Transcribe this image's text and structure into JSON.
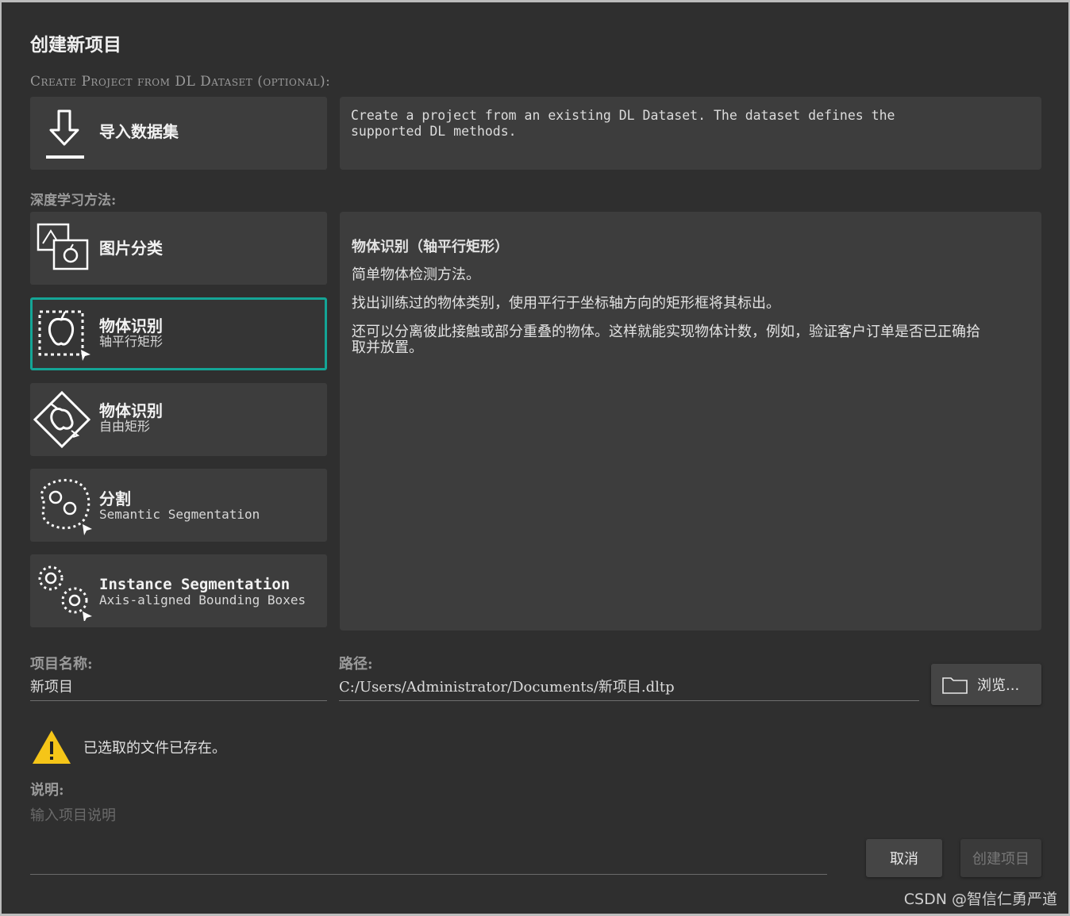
{
  "dialog": {
    "title": "创建新项目",
    "import_section_label": "Create Project from DL Dataset (optional):",
    "import_button_label": "导入数据集",
    "import_description": "Create a project from an existing DL Dataset. The dataset defines the\nsupported DL methods.",
    "methods_label": "深度学习方法:",
    "methods": [
      {
        "main": "图片分类",
        "sub": "",
        "icon": "image-classification-icon",
        "selected": false
      },
      {
        "main": "物体识别",
        "sub": "轴平行矩形",
        "icon": "object-detection-axis-aligned-icon",
        "selected": true
      },
      {
        "main": "物体识别",
        "sub": "自由矩形",
        "icon": "object-detection-rotated-icon",
        "selected": false
      },
      {
        "main": "分割",
        "sub": "Semantic Segmentation",
        "icon": "semantic-segmentation-icon",
        "selected": false
      },
      {
        "main": "Instance Segmentation",
        "sub": "Axis-aligned Bounding Boxes",
        "icon": "instance-segmentation-icon",
        "selected": false
      }
    ],
    "method_description": {
      "heading": "物体识别（轴平行矩形）",
      "paragraphs": [
        "简单物体检测方法。",
        "找出训练过的物体类别，使用平行于坐标轴方向的矩形框将其标出。",
        "还可以分离彼此接触或部分重叠的物体。这样就能实现物体计数，例如，验证客户订单是否已正确拾取并放置。"
      ]
    },
    "project_name_label": "项目名称:",
    "project_name_value": "新项目",
    "path_label": "路径:",
    "path_value": "C:/Users/Administrator/Documents/新项目.dltp",
    "browse_label": "浏览...",
    "warning_text": "已选取的文件已存在。",
    "description_label": "说明:",
    "description_placeholder": "输入项目说明",
    "cancel_label": "取消",
    "create_label": "创建项目"
  },
  "watermark": "CSDN @智信仁勇严道",
  "colors": {
    "background": "#2f2f2f",
    "card": "#3d3d3d",
    "accent": "#14a596",
    "warning": "#f5c518"
  }
}
